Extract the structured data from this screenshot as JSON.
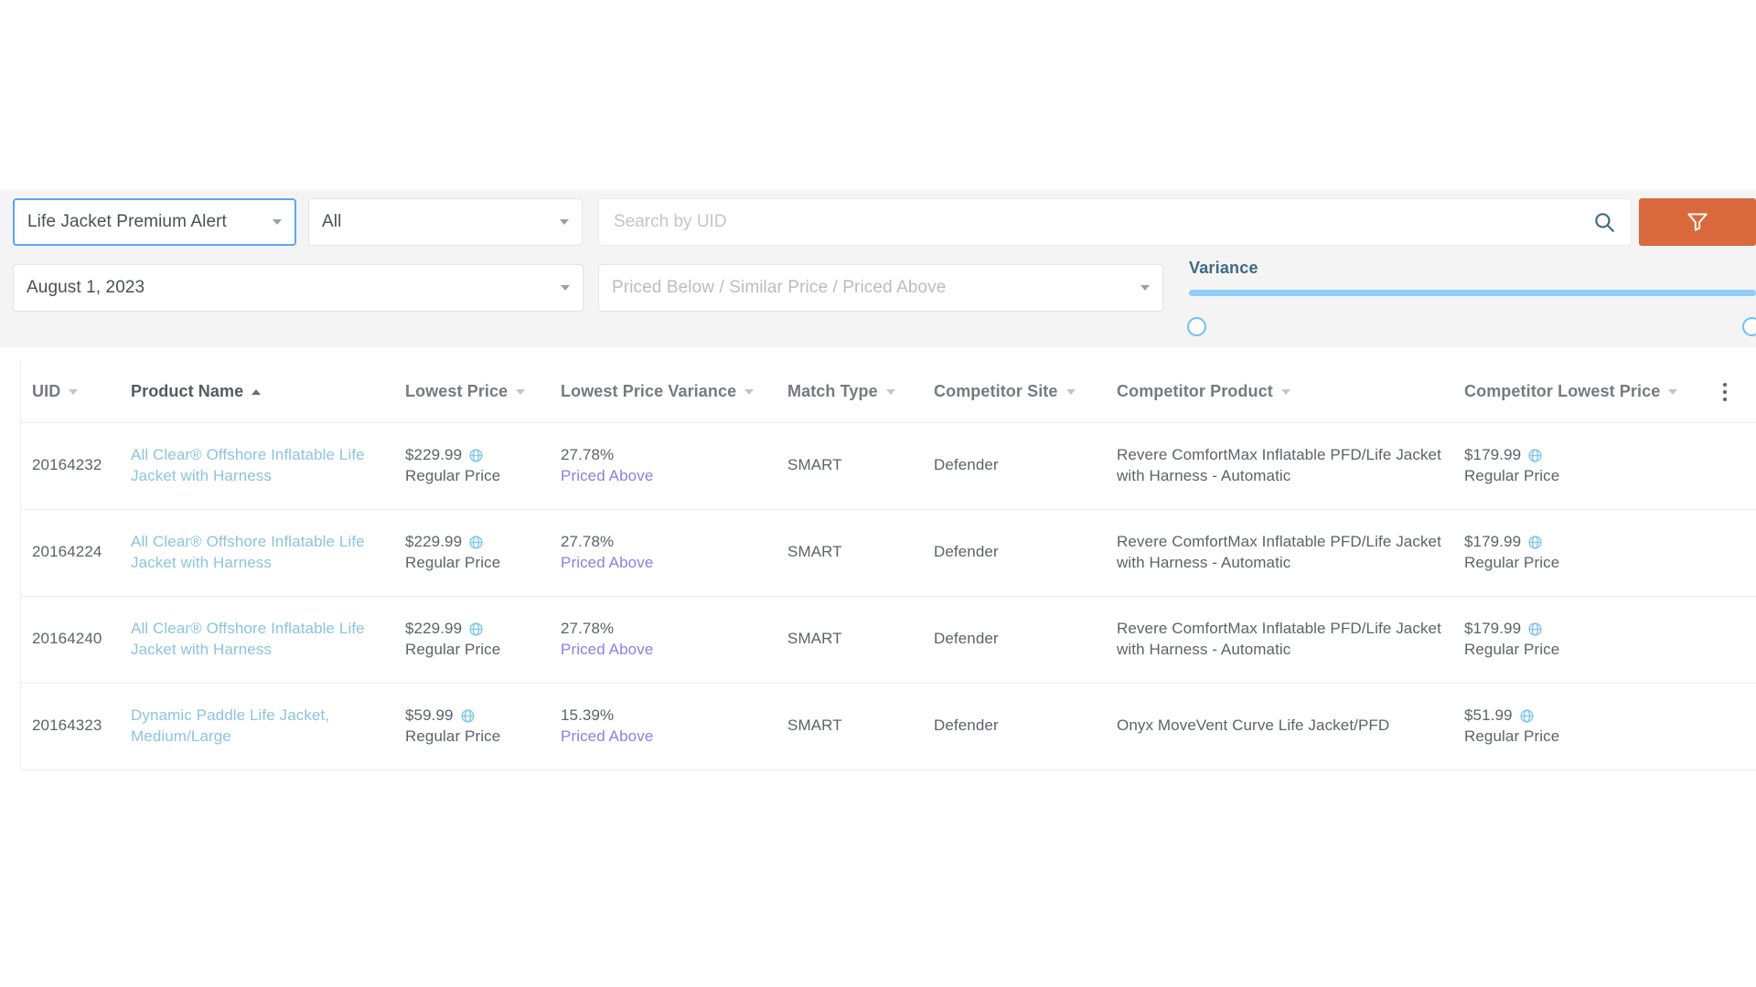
{
  "colors": {
    "filter_button": "#d9693c",
    "link": "#8bc4de",
    "priced_above": "#8c7ee8",
    "slider": "#8fcdf7",
    "variance_label": "#3d6a87",
    "toolbar_bg": "#f4f4f4"
  },
  "toolbar": {
    "alert_select": {
      "value": "Life Jacket Premium Alert"
    },
    "scope_select": {
      "value": "All"
    },
    "search": {
      "value": "",
      "placeholder": "Search by UID"
    },
    "date_select": {
      "value": "August 1, 2023"
    },
    "status_select": {
      "value": "",
      "placeholder": "Priced Below / Similar Price / Priced Above"
    },
    "variance": {
      "label": "Variance",
      "min_value": 0,
      "max_value": 100
    },
    "search_icon": "search-icon",
    "filter_icon": "filter-funnel-icon"
  },
  "table": {
    "columns": [
      {
        "key": "uid",
        "label": "UID",
        "sort": "none"
      },
      {
        "key": "product_name",
        "label": "Product Name",
        "sort": "asc"
      },
      {
        "key": "lowest_price",
        "label": "Lowest Price",
        "sort": "none"
      },
      {
        "key": "lowest_price_variance",
        "label": "Lowest Price Variance",
        "sort": "none"
      },
      {
        "key": "match_type",
        "label": "Match Type",
        "sort": "none"
      },
      {
        "key": "competitor_site",
        "label": "Competitor Site",
        "sort": "none"
      },
      {
        "key": "competitor_product",
        "label": "Competitor Product",
        "sort": "none"
      },
      {
        "key": "competitor_lowest_price",
        "label": "Competitor Lowest Price",
        "sort": "none"
      }
    ],
    "menu_icon": "kebab-menu-icon",
    "rows": [
      {
        "uid": "20164232",
        "product_name": "All Clear® Offshore Inflatable Life Jacket with Harness",
        "lowest_price": "$229.99",
        "lowest_price_type": "Regular Price",
        "variance_pct": "27.78%",
        "variance_status": "Priced Above",
        "match_type": "SMART",
        "competitor_site": "Defender",
        "competitor_product": "Revere ComfortMax Inflatable PFD/Life Jacket with Harness - Automatic",
        "competitor_lowest_price": "$179.99",
        "competitor_price_type": "Regular Price"
      },
      {
        "uid": "20164224",
        "product_name": "All Clear® Offshore Inflatable Life Jacket with Harness",
        "lowest_price": "$229.99",
        "lowest_price_type": "Regular Price",
        "variance_pct": "27.78%",
        "variance_status": "Priced Above",
        "match_type": "SMART",
        "competitor_site": "Defender",
        "competitor_product": "Revere ComfortMax Inflatable PFD/Life Jacket with Harness - Automatic",
        "competitor_lowest_price": "$179.99",
        "competitor_price_type": "Regular Price"
      },
      {
        "uid": "20164240",
        "product_name": "All Clear® Offshore Inflatable Life Jacket with Harness",
        "lowest_price": "$229.99",
        "lowest_price_type": "Regular Price",
        "variance_pct": "27.78%",
        "variance_status": "Priced Above",
        "match_type": "SMART",
        "competitor_site": "Defender",
        "competitor_product": "Revere ComfortMax Inflatable PFD/Life Jacket with Harness - Automatic",
        "competitor_lowest_price": "$179.99",
        "competitor_price_type": "Regular Price"
      },
      {
        "uid": "20164323",
        "product_name": "Dynamic Paddle Life Jacket, Medium/Large",
        "lowest_price": "$59.99",
        "lowest_price_type": "Regular Price",
        "variance_pct": "15.39%",
        "variance_status": "Priced Above",
        "match_type": "SMART",
        "competitor_site": "Defender",
        "competitor_product": "Onyx MoveVent Curve Life Jacket/PFD",
        "competitor_lowest_price": "$51.99",
        "competitor_price_type": "Regular Price"
      }
    ]
  }
}
